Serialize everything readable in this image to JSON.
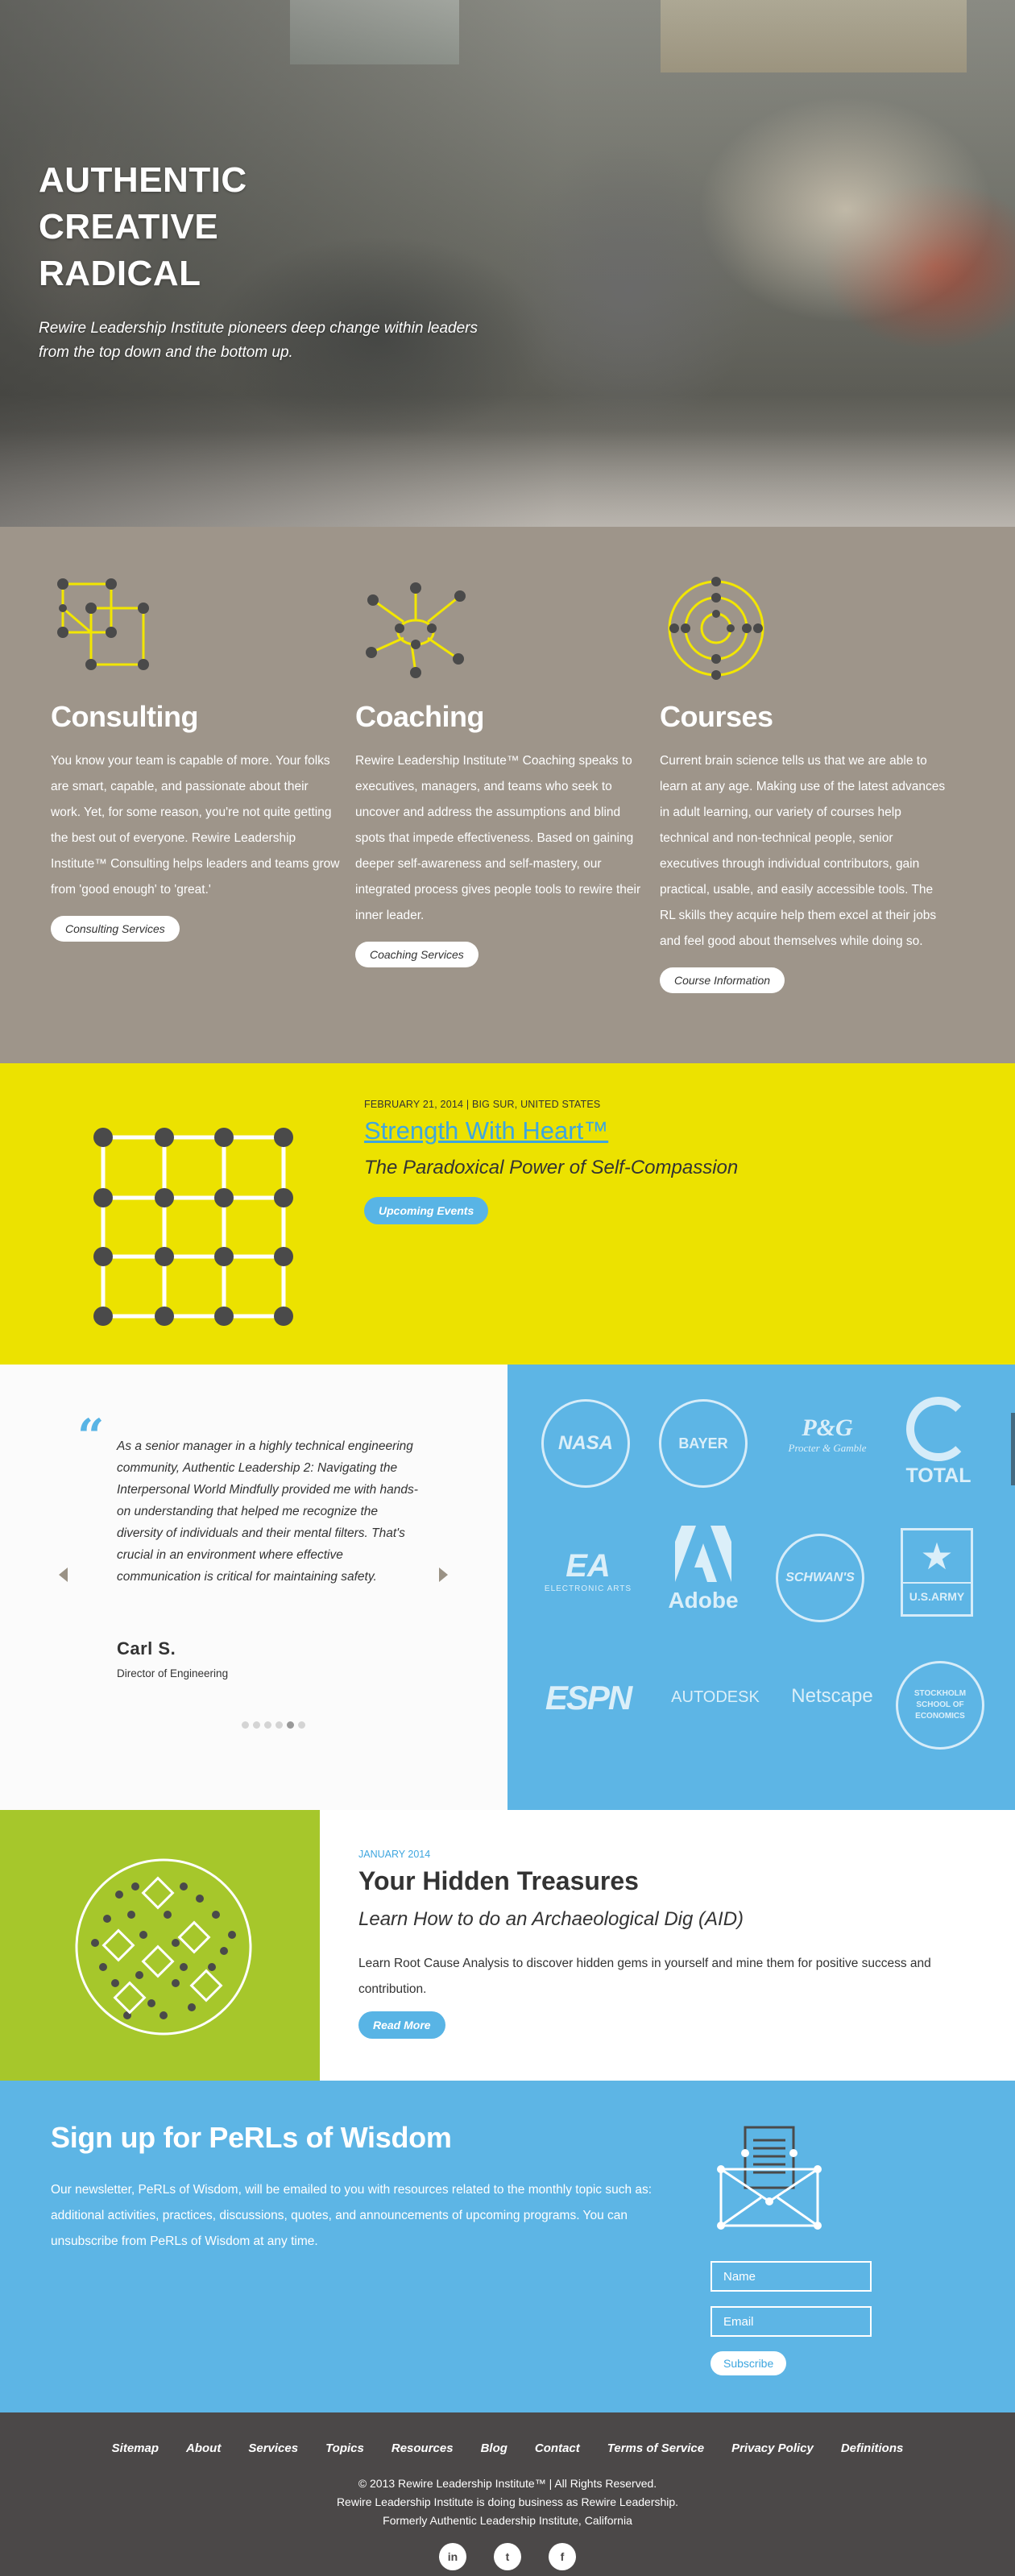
{
  "hero": {
    "title_line1": "AUTHENTIC",
    "title_line2": "CREATIVE",
    "title_line3": "RADICAL",
    "subtitle": "Rewire Leadership Institute pioneers deep change within leaders from the top down and the bottom up."
  },
  "services": [
    {
      "title": "Consulting",
      "icon": "interlocking-squares-icon",
      "text": "You know your team is capable of more. Your folks are smart, capable, and passionate about their work. Yet, for some reason, you're not quite getting the best out of everyone. Rewire Leadership Institute™ Consulting helps leaders and teams grow from 'good enough' to 'great.'",
      "button": "Consulting Services"
    },
    {
      "title": "Coaching",
      "icon": "network-nodes-icon",
      "text": "Rewire Leadership Institute™ Coaching speaks to executives, managers, and teams who seek to uncover and address the assumptions and blind spots that impede effectiveness. Based on gaining deeper self-awareness and self-mastery, our integrated process gives people tools to rewire their inner leader.",
      "button": "Coaching Services"
    },
    {
      "title": "Courses",
      "icon": "concentric-circles-icon",
      "text": "Current brain science tells us that we are able to learn at any age. Making use of the latest advances in adult learning, our variety of courses help technical and non-technical people, senior executives through individual contributors, gain practical, usable, and easily accessible tools. The RL skills they acquire help them excel at their jobs and feel good about themselves while doing so.",
      "button": "Course Information"
    }
  ],
  "event": {
    "meta": "FEBRUARY 21, 2014 | BIG SUR, UNITED STATES",
    "title": "Strength With Heart™",
    "subtitle": "The Paradoxical Power of Self-Compassion",
    "button": "Upcoming Events",
    "icon": "dot-grid-icon"
  },
  "testimonial": {
    "quote": "As a senior manager in a highly technical engineering community, Authentic Leadership 2: Navigating the Interpersonal World Mindfully provided me with hands-on understanding that helped me recognize the diversity of individuals and their mental filters. That's crucial in an environment where effective communication is critical for maintaining safety.",
    "author": "Carl S.",
    "role": "Director of Engineering",
    "dot_count": 6,
    "active_dot": 5
  },
  "logos": {
    "nasa": "NASA",
    "bayer": "BAYER",
    "pg": "P&G",
    "pg_sub": "Procter & Gamble",
    "total": "TOTAL",
    "ea": "EA",
    "ea_sub": "ELECTRONIC ARTS",
    "adobe": "Adobe",
    "schwans": "SCHWAN'S",
    "usarmy": "U.S.ARMY",
    "espn": "ESPN",
    "autodesk": "AUTODESK",
    "netscape": "Netscape",
    "stockholm": "STOCKHOLM SCHOOL OF ECONOMICS"
  },
  "treasure": {
    "date": "JANUARY 2014",
    "title": "Your Hidden Treasures",
    "subtitle": "Learn How to do an Archaeological Dig (AID)",
    "text": "Learn Root Cause Analysis to discover hidden gems in yourself and mine them for positive success and contribution.",
    "button": "Read More",
    "icon": "dig-site-icon"
  },
  "newsletter": {
    "title": "Sign up for PeRLs of Wisdom",
    "text": "Our newsletter, PeRLs of Wisdom, will be emailed to you with resources related to the monthly topic such as: additional activities, practices, discussions, quotes, and announcements of upcoming programs. You can unsubscribe from PeRLs of Wisdom at any time.",
    "name_placeholder": "Name",
    "email_placeholder": "Email",
    "button": "Subscribe",
    "icon": "envelope-newsletter-icon"
  },
  "footer": {
    "nav": [
      "Sitemap",
      "About",
      "Services",
      "Topics",
      "Resources",
      "Blog",
      "Contact",
      "Terms of Service",
      "Privacy Policy",
      "Definitions"
    ],
    "legal1": "© 2013 Rewire Leadership Institute™ | All Rights Reserved.",
    "legal2": "Rewire Leadership Institute is doing business as Rewire Leadership.",
    "legal3": "Formerly Authentic Leadership Institute, California",
    "social": [
      "in",
      "t",
      "f"
    ]
  },
  "colors": {
    "services_bg": "#9e958a",
    "event_bg": "#ece200",
    "accent_blue": "#58b4e5",
    "logos_bg": "#5db5e5",
    "treasure_green": "#a6c72b",
    "footer_bg": "#4b4848"
  }
}
